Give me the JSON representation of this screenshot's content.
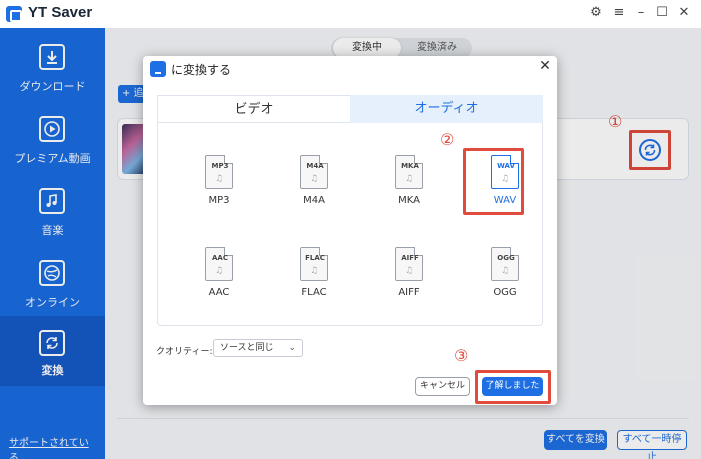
{
  "app": {
    "title": "YT Saver"
  },
  "sidebar": {
    "items": [
      {
        "label": "ダウンロード",
        "icon": "download-icon"
      },
      {
        "label": "プレミアム動画",
        "icon": "play-icon"
      },
      {
        "label": "音楽",
        "icon": "music-note-icon"
      },
      {
        "label": "オンライン",
        "icon": "globe-icon"
      },
      {
        "label": "変換",
        "icon": "convert-icon",
        "active": true
      }
    ],
    "support_link": "サポートされている..."
  },
  "main": {
    "tabs": [
      {
        "label": "変換中",
        "active": true
      },
      {
        "label": "変換済み",
        "active": false
      }
    ],
    "add_button": "+ 追",
    "bottom_buttons": {
      "convert_all": "すべてを変換",
      "pause_all": "すべて一時停止"
    }
  },
  "dialog": {
    "title": "に変換する",
    "tabs": [
      {
        "label": "ビデオ",
        "active": false
      },
      {
        "label": "オーディオ",
        "active": true
      }
    ],
    "formats": [
      {
        "ext": "MP3",
        "label": "MP3"
      },
      {
        "ext": "M4A",
        "label": "M4A"
      },
      {
        "ext": "MKA",
        "label": "MKA"
      },
      {
        "ext": "WAV",
        "label": "WAV",
        "selected": true
      },
      {
        "ext": "AAC",
        "label": "AAC"
      },
      {
        "ext": "FLAC",
        "label": "FLAC"
      },
      {
        "ext": "AIFF",
        "label": "AIFF"
      },
      {
        "ext": "OGG",
        "label": "OGG"
      }
    ],
    "quality": {
      "label": "クオリティー:",
      "value": "ソースと同じ"
    },
    "cancel_button": "キャンセル",
    "ok_button": "了解しました"
  },
  "annotations": {
    "step1": "①",
    "step2": "②",
    "step3": "③"
  },
  "colors": {
    "brand": "#1e6fe3",
    "sidebar": "#1a6de3",
    "highlight": "#e04b3d"
  }
}
